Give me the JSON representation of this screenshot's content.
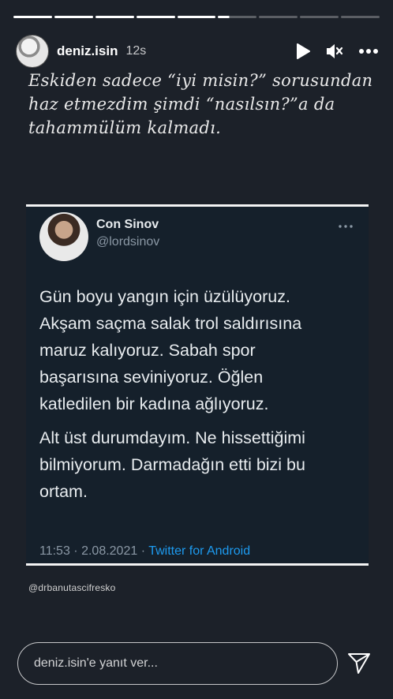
{
  "story": {
    "segments": [
      1,
      1,
      1,
      1,
      1,
      0.3,
      0,
      0,
      0
    ],
    "username": "deniz.isin",
    "time": "12s",
    "caption_lines": [
      "Eskiden sadece “iyi misin?” sorusundan",
      "haz etmezdim şimdi “nasılsın?”a da",
      "tahammülüm kalmadı."
    ],
    "credit": "@drbanutascifresko",
    "reply_placeholder": "deniz.isin'e yanıt ver...",
    "icons": [
      "play-icon",
      "mute-icon",
      "more-icon",
      "send-icon"
    ]
  },
  "tweet": {
    "name": "Con Sinov",
    "handle": "@lordsinov",
    "paragraphs": [
      [
        "Gün boyu yangın için üzülüyoruz.",
        "Akşam saçma salak trol saldırısına",
        "maruz kalıyoruz. Sabah spor",
        "başarısına seviniyoruz. Öğlen",
        "katledilen bir kadına ağlıyoruz."
      ],
      [
        "Alt üst durumdayım. Ne hissettiğimi",
        "bilmiyorum. Darmadağın etti bizi bu",
        "ortam."
      ]
    ],
    "date": "11:53 · 2.08.2021 · ",
    "source": "Twitter for Android"
  },
  "colors": {
    "background": "#1c2129",
    "card": "#15202b",
    "link": "#1d9bf0",
    "muted": "#8b98a5"
  }
}
